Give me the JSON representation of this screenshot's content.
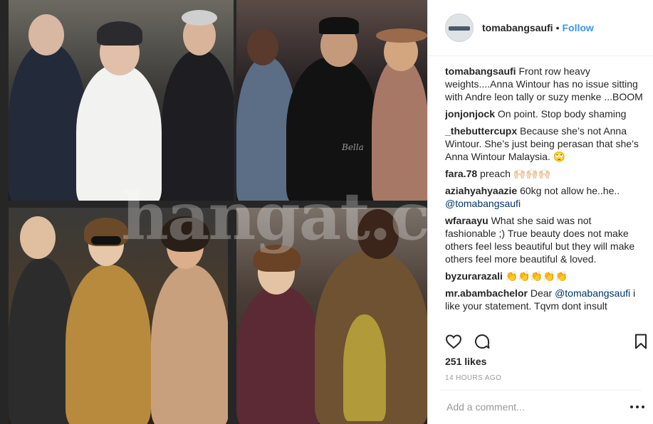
{
  "post": {
    "username": "tomabangsaufi",
    "separator": "•",
    "follow_label": "Follow",
    "watermark": "hangat.c",
    "image_tag": "Bella",
    "likes": "251 likes",
    "time": "14 HOURS AGO",
    "add_comment_placeholder": "Add a comment..."
  },
  "comments": [
    {
      "user": "tomabangsaufi",
      "text": "Front row heavy weights....Anna Wintour has no issue sitting with Andre leon tally or suzy menke ...BOOM"
    },
    {
      "user": "jonjonjock",
      "text": "On point. Stop body shaming"
    },
    {
      "user": "_thebuttercupx",
      "text": "Because she’s not Anna Wintour. She’s just being perasan that she’s Anna Wintour Malaysia.",
      "emoji": "🙄"
    },
    {
      "user": "fara.78",
      "text": "preach",
      "emoji": "🙌🏻🙌🏻🙌🏻"
    },
    {
      "user": "aziahyahyaazie",
      "text": "60kg not allow he..he..",
      "mention": "@tomabangsaufi"
    },
    {
      "user": "wfaraayu",
      "text": "What she said was not fashionable ;) True beauty does not make others feel less beautiful but they will make others feel more beautiful & loved."
    },
    {
      "user": "byzurarazali",
      "text": "",
      "emoji": "👏👏👏👏👏"
    },
    {
      "user": "mr.abambachelor",
      "text": "Dear",
      "mention": "@tomabangsaufi",
      "text2": "i like your statement. Tqvm dont insult"
    }
  ],
  "icons": {
    "like": "heart-icon",
    "comment": "comment-icon",
    "save": "bookmark-icon",
    "more": "more-options-icon"
  }
}
